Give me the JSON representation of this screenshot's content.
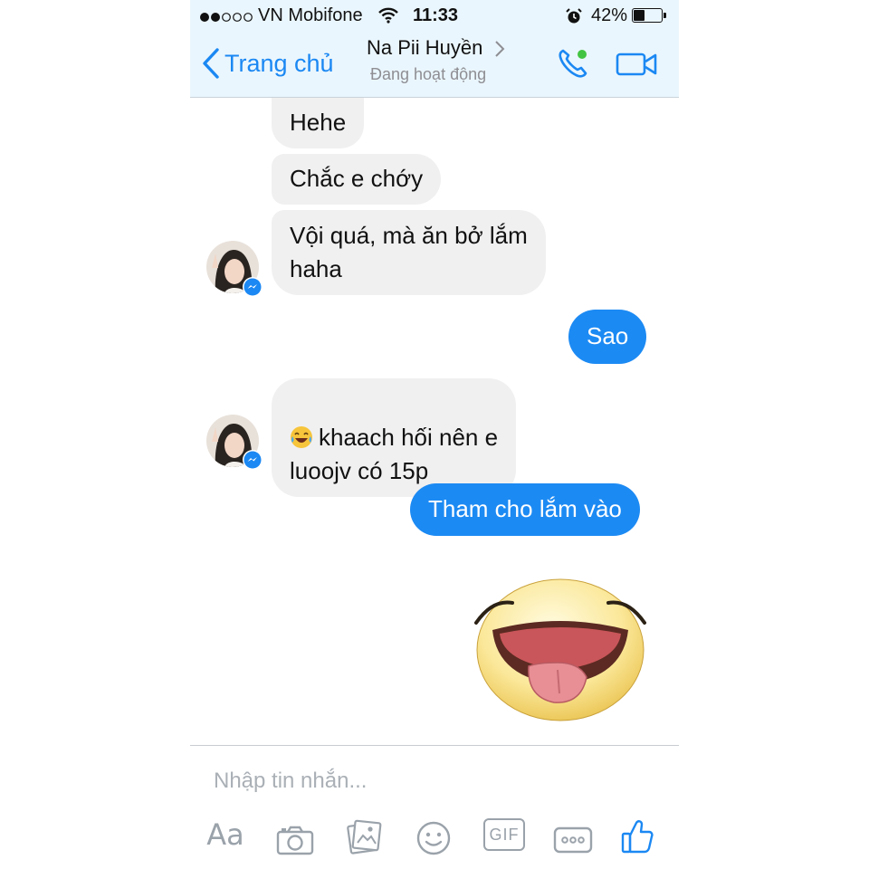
{
  "status_bar": {
    "carrier": "VN Mobifone",
    "time": "11:33",
    "battery": "42%",
    "battery_level": 0.42,
    "signal_bars_filled": 2,
    "signal_bars_total": 5
  },
  "header": {
    "back_label": "Trang chủ",
    "contact_name": "Na Pii Huyền",
    "contact_status": "Đang hoạt động",
    "accent_color": "#1b88f3"
  },
  "messages": [
    {
      "direction": "incoming",
      "text": "Hehe"
    },
    {
      "direction": "incoming",
      "text": "Chắc e chớy"
    },
    {
      "direction": "incoming",
      "text": "Vội quá, mà ăn bở lắm\nhaha"
    },
    {
      "direction": "outgoing",
      "text": "Sao"
    },
    {
      "direction": "incoming",
      "emoji": "laughing-tears-emoji",
      "text": "khaach hối nên e\nluoojv có 15p"
    },
    {
      "direction": "outgoing",
      "text": "Tham cho lắm vào"
    },
    {
      "direction": "outgoing",
      "sticker": "tongue-out-face-sticker"
    }
  ],
  "composer": {
    "placeholder": "Nhập tin nhắn...",
    "toolbar": [
      "Aa",
      "camera-icon",
      "gallery-icon",
      "sticker-smile-icon",
      "GIF",
      "more-icon",
      "thumbs-up-icon"
    ],
    "gif_label": "GIF"
  },
  "colors": {
    "incoming_bubble": "#f1f0f0",
    "outgoing_bubble": "#1c8af3",
    "header_bg": "#eaf6fd",
    "toolbar_icon": "#9aa2aa"
  }
}
